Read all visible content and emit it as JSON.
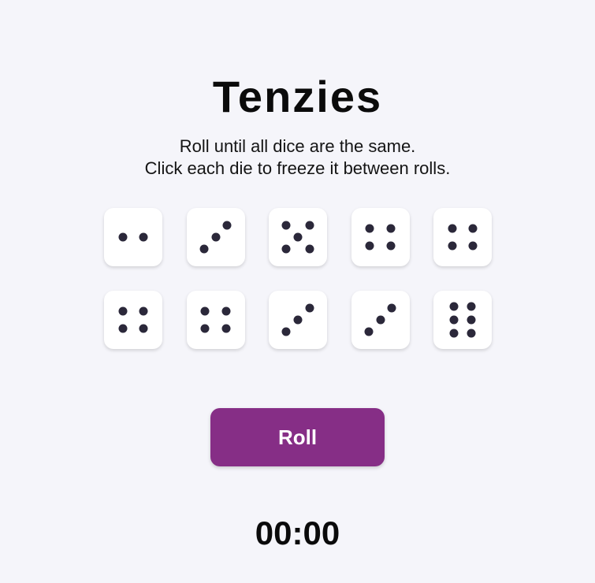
{
  "title": "Tenzies",
  "instructions": {
    "line1": "Roll until all dice are the same.",
    "line2": "Click each die to freeze it between rolls."
  },
  "dice": [
    {
      "value": 2,
      "held": false
    },
    {
      "value": 3,
      "held": false
    },
    {
      "value": 5,
      "held": false
    },
    {
      "value": 4,
      "held": false
    },
    {
      "value": 4,
      "held": false
    },
    {
      "value": 4,
      "held": false
    },
    {
      "value": 4,
      "held": false
    },
    {
      "value": 3,
      "held": false
    },
    {
      "value": 3,
      "held": false
    },
    {
      "value": 6,
      "held": false
    }
  ],
  "roll_button": {
    "label": "Roll"
  },
  "timer": "00:00",
  "colors": {
    "background": "#f5f5fa",
    "die": "#ffffff",
    "pip": "#2b283a",
    "button": "#862e86",
    "button_text": "#ffffff"
  }
}
